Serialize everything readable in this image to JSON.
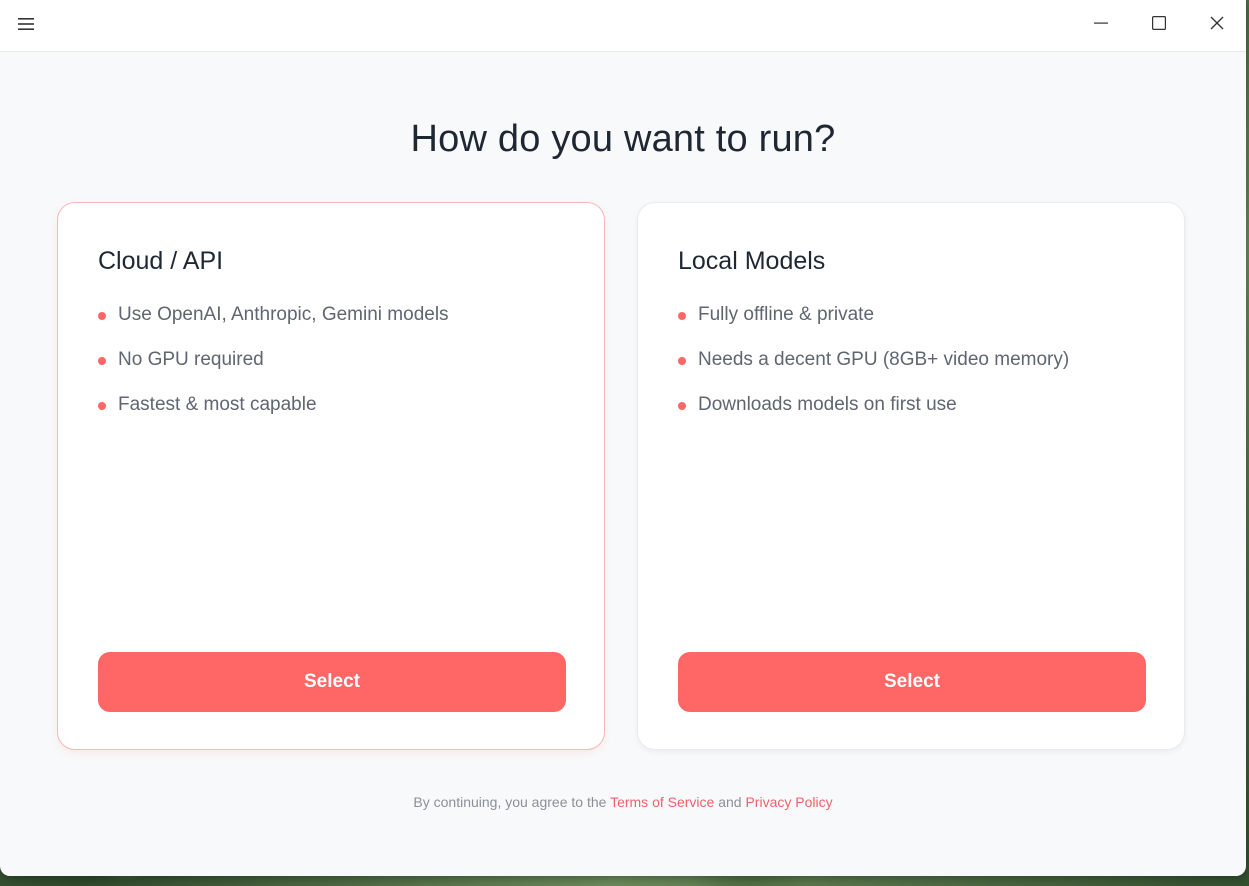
{
  "window": {
    "menu_icon": "hamburger-menu-icon",
    "controls": [
      "minimize-icon",
      "maximize-icon",
      "close-icon"
    ]
  },
  "headline": "How do you want to run?",
  "options": [
    {
      "title": "Cloud / API",
      "features": [
        "Use OpenAI, Anthropic, Gemini models",
        "No GPU required",
        "Fastest & most capable"
      ],
      "button_label": "Select",
      "selected": true
    },
    {
      "title": "Local Models",
      "features": [
        "Fully offline & private",
        "Needs a decent GPU (8GB+ video memory)",
        "Downloads models on first use"
      ],
      "button_label": "Select",
      "selected": false
    }
  ],
  "footer": {
    "prefix": "By continuing, you agree to the",
    "terms_link": "Terms of Service",
    "conjunction": "and",
    "privacy_link": "Privacy Policy"
  },
  "colors": {
    "accent": "#ff6666",
    "heading": "#1f2733",
    "body_text": "#5f6670",
    "muted": "#8a9099",
    "link": "#f0606a"
  }
}
